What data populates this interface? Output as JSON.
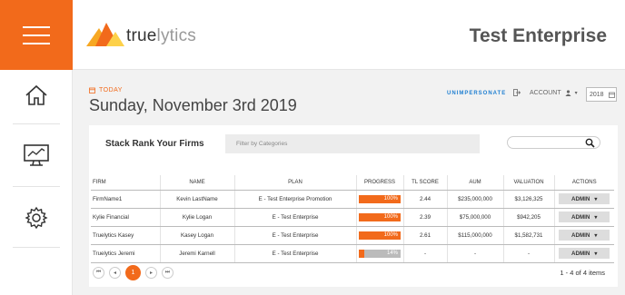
{
  "sidebar": {
    "icons": [
      "menu-icon",
      "home-icon",
      "monitor-chart-icon",
      "gear-icon"
    ],
    "accent": "#f26a1b"
  },
  "header": {
    "logo_true": "true",
    "logo_lytics": "lytics",
    "title": "Test Enterprise"
  },
  "subheader": {
    "today_label": "TODAY",
    "date": "Sunday, November 3rd 2019",
    "unimpersonate": "UNIMPERSONATE",
    "account": "ACCOUNT",
    "year": "2018"
  },
  "card": {
    "title": "Stack Rank Your Firms",
    "filter_placeholder": "Filter by Categories",
    "columns": [
      "FIRM",
      "NAME",
      "PLAN",
      "PROGRESS",
      "TL SCORE",
      "AUM",
      "VALUATION",
      "ACTIONS"
    ],
    "rows": [
      {
        "firm": "FirmName1",
        "name": "Kevin LastName",
        "plan": "E - Test Enterprise Promotion",
        "progress": 100,
        "progress_label": "100%",
        "score": "2.44",
        "aum": "$235,000,000",
        "valuation": "$3,126,325",
        "action": "ADMIN"
      },
      {
        "firm": "Kylie Financial",
        "name": "Kylie Logan",
        "plan": "E - Test Enterprise",
        "progress": 100,
        "progress_label": "100%",
        "score": "2.39",
        "aum": "$75,000,000",
        "valuation": "$942,205",
        "action": "ADMIN"
      },
      {
        "firm": "Truelytics Kasey",
        "name": "Kasey Logan",
        "plan": "E - Test Enterprise",
        "progress": 100,
        "progress_label": "100%",
        "score": "2.61",
        "aum": "$115,000,000",
        "valuation": "$1,582,731",
        "action": "ADMIN"
      },
      {
        "firm": "Truelytics Jeremi",
        "name": "Jeremi Karnell",
        "plan": "E - Test Enterprise",
        "progress": 14,
        "progress_label": "14%",
        "score": "-",
        "aum": "-",
        "valuation": "-",
        "action": "ADMIN"
      }
    ],
    "pager": {
      "first": "⏮",
      "prev": "◂",
      "current": "1",
      "next": "▸",
      "last": "⏭"
    },
    "items_summary": "1 - 4 of 4 items"
  }
}
